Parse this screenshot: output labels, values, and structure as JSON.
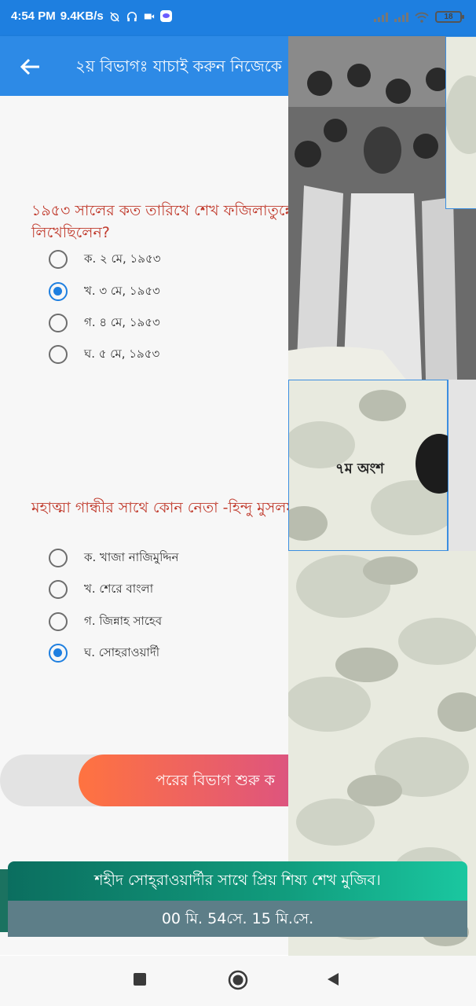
{
  "status_bar": {
    "time": "4:54 PM",
    "speed": "9.4KB/s",
    "battery": "18"
  },
  "app_bar": {
    "title": "২য় বিভাগঃ  যাচাই করুন নিজেকে"
  },
  "questions": [
    {
      "text": "১৯৫৩ সালের কত তারিখে শেখ ফজিলাতুন্নে জন্য সংক্রান্ত চিঠি লিখেছিলেন?",
      "options": [
        {
          "label": "ক. ২ মে, ১৯৫৩",
          "selected": false
        },
        {
          "label": "খ. ৩ মে, ১৯৫৩",
          "selected": true
        },
        {
          "label": "গ. ৪ মে, ১৯৫৩",
          "selected": false
        },
        {
          "label": "ঘ. ৫ মে, ১৯৫৩",
          "selected": false
        }
      ]
    },
    {
      "text": "মহাত্মা গান্ধীর সাথে কোন নেতা -হিন্দু মুসলম উদ্দেশ্যে কাজ করেছিলো?",
      "options": [
        {
          "label": "ক. খাজা নাজিমুদ্দিন",
          "selected": false
        },
        {
          "label": "খ. শেরে বাংলা",
          "selected": false
        },
        {
          "label": "গ. জিন্নাহ সাহেব",
          "selected": false
        },
        {
          "label": "ঘ. সোহরাওয়ার্দী",
          "selected": true
        }
      ]
    }
  ],
  "next_button": {
    "label": "পরের বিভাগ শুরু ক"
  },
  "puzzle": {
    "piece_label": "৭ম অংশ"
  },
  "caption": "শহীদ সোহ্‌রাওয়ার্দীর সাথে প্রিয় শিষ্য শেখ মুজিব।",
  "timer": "00 মি.  54সে.  15 মি.সে.",
  "colors": {
    "app_blue": "#2d8ae6",
    "question_red": "#c0392b",
    "radio_selected": "#1e7fe0",
    "caption_green": "#119c7d",
    "timer_slate": "#5d7e88"
  },
  "icons": {
    "back": "arrow-left-icon",
    "nav_recent": "square-icon",
    "nav_home": "circle-icon",
    "nav_back": "triangle-left-icon"
  }
}
